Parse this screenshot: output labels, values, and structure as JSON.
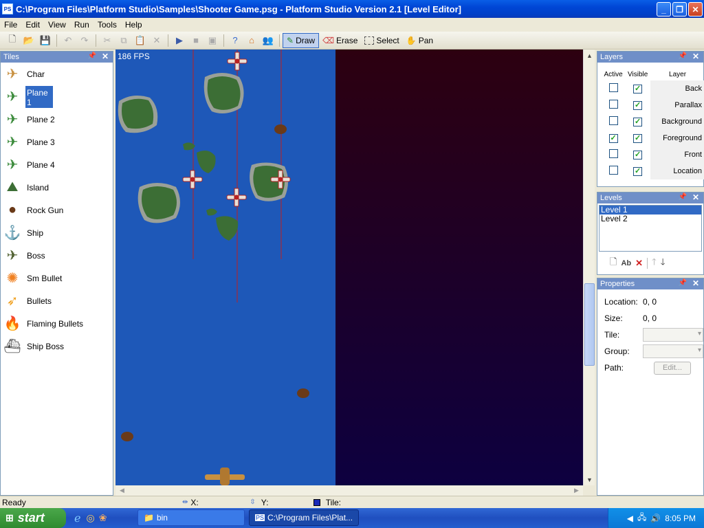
{
  "window": {
    "title": "C:\\Program Files\\Platform Studio\\Samples\\Shooter Game.psg - Platform Studio Version 2.1 [Level Editor]",
    "app_icon": "PS"
  },
  "menu": [
    "File",
    "Edit",
    "View",
    "Run",
    "Tools",
    "Help"
  ],
  "toolbar": {
    "draw": "Draw",
    "erase": "Erase",
    "select": "Select",
    "pan": "Pan"
  },
  "tiles_panel": {
    "title": "Tiles",
    "items": [
      {
        "label": "Char",
        "icon": "char-plane-icon"
      },
      {
        "label": "Plane 1",
        "icon": "plane-icon"
      },
      {
        "label": "Plane 2",
        "icon": "plane-icon"
      },
      {
        "label": "Plane 3",
        "icon": "plane-icon"
      },
      {
        "label": "Plane 4",
        "icon": "plane-icon"
      },
      {
        "label": "Island",
        "icon": "island-icon"
      },
      {
        "label": "Rock Gun",
        "icon": "rock-gun-icon"
      },
      {
        "label": "Ship",
        "icon": "ship-icon"
      },
      {
        "label": "Boss",
        "icon": "boss-plane-icon"
      },
      {
        "label": "Sm Bullet",
        "icon": "small-bullet-icon"
      },
      {
        "label": "Bullets",
        "icon": "bullets-icon"
      },
      {
        "label": "Flaming Bullets",
        "icon": "flaming-bullet-icon"
      },
      {
        "label": "Ship Boss",
        "icon": "ship-boss-icon"
      }
    ],
    "selected": "Plane 1"
  },
  "game": {
    "fps": "186 FPS"
  },
  "layers_panel": {
    "title": "Layers",
    "columns": [
      "Active",
      "Visible",
      "Layer"
    ],
    "rows": [
      {
        "name": "Back",
        "active": false,
        "visible": true
      },
      {
        "name": "Parallax",
        "active": false,
        "visible": true
      },
      {
        "name": "Background",
        "active": false,
        "visible": true
      },
      {
        "name": "Foreground",
        "active": true,
        "visible": true
      },
      {
        "name": "Front",
        "active": false,
        "visible": true
      },
      {
        "name": "Location",
        "active": false,
        "visible": true
      }
    ]
  },
  "levels_panel": {
    "title": "Levels",
    "items": [
      "Level 1",
      "Level 2"
    ],
    "selected": "Level 1"
  },
  "properties_panel": {
    "title": "Properties",
    "location_label": "Location:",
    "location_value": "0, 0",
    "size_label": "Size:",
    "size_value": "0, 0",
    "tile_label": "Tile:",
    "group_label": "Group:",
    "path_label": "Path:",
    "edit_button": "Edit..."
  },
  "status": {
    "text": "Ready",
    "x_label": "X:",
    "y_label": "Y:",
    "tile_label": "Tile:"
  },
  "taskbar": {
    "start": "start",
    "items": [
      "bin",
      "C:\\Program Files\\Plat..."
    ],
    "clock": "8:05 PM"
  }
}
